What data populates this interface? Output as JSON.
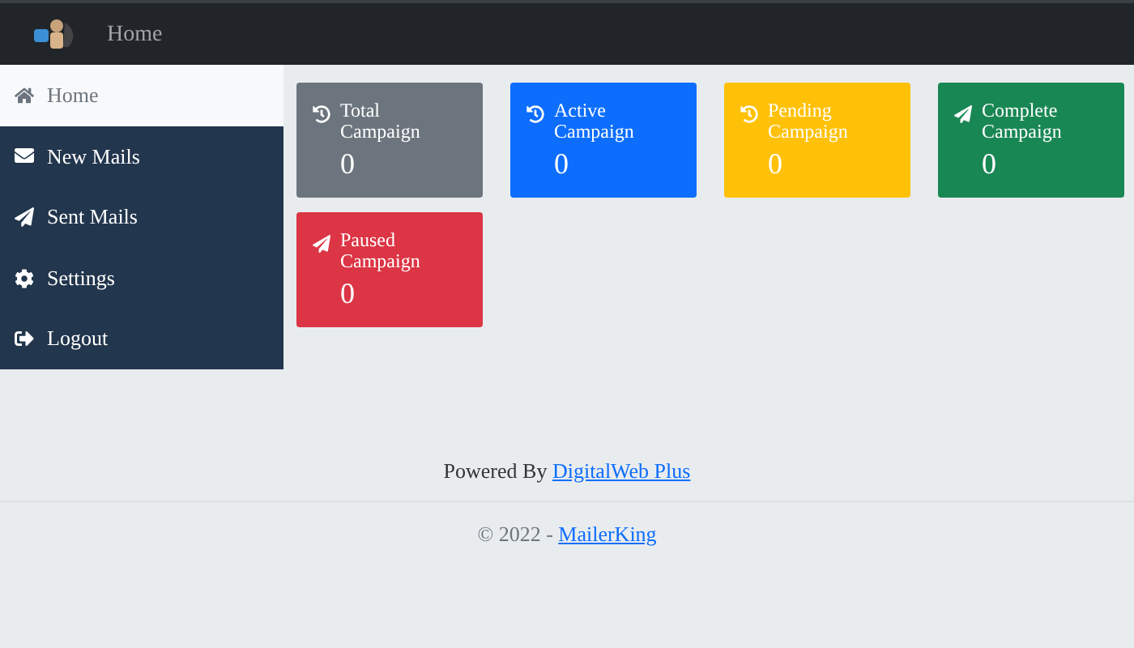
{
  "navbar": {
    "title": "Home"
  },
  "sidebar": {
    "items": [
      {
        "label": "Home",
        "selected": true
      },
      {
        "label": "New Mails",
        "selected": false
      },
      {
        "label": "Sent Mails",
        "selected": false
      },
      {
        "label": "Settings",
        "selected": false
      },
      {
        "label": "Logout",
        "selected": false
      }
    ]
  },
  "cards": [
    {
      "kind": "tally",
      "title": "Total Campaign",
      "value": "0",
      "color": "#6c757d"
    },
    {
      "kind": "tally",
      "title": "Active Campaign",
      "value": "0",
      "color": "#0d6efd"
    },
    {
      "kind": "tally",
      "title": "Pending Campaign",
      "value": "0",
      "color": "#ffc107"
    },
    {
      "kind": "sent",
      "title": "Complete Campaign",
      "value": "0",
      "color": "#198754"
    },
    {
      "kind": "sent",
      "title": "Paused Campaign",
      "value": "0",
      "color": "#dc3545"
    }
  ],
  "footer": {
    "powered_text": "Powered By",
    "powered_link": "DigitalWeb Plus",
    "copyright_text": "© 2022 -",
    "copyright_link": "MailerKing"
  }
}
